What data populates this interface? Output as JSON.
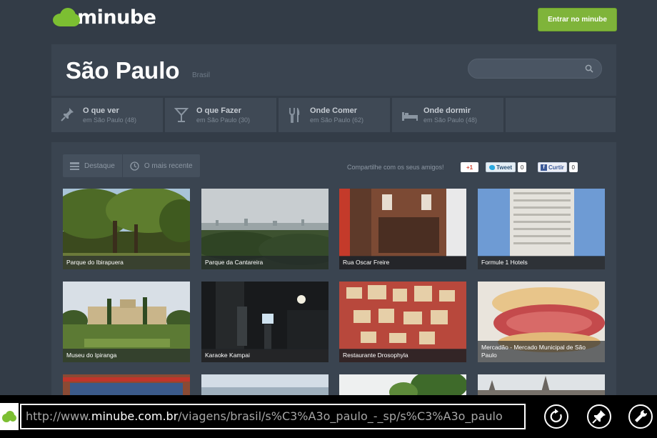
{
  "brand": {
    "logo_text": "minube",
    "accent": "#7fb43a"
  },
  "header": {
    "enter_button": "Entrar no minube"
  },
  "city": {
    "name": "São Paulo",
    "country": "Brasil",
    "search_placeholder": ""
  },
  "nav": [
    {
      "title": "O que ver",
      "sub": "em São Paulo (48)",
      "icon": "pin-icon"
    },
    {
      "title": "O que Fazer",
      "sub": "em São Paulo (30)",
      "icon": "cocktail-icon"
    },
    {
      "title": "Onde Comer",
      "sub": "em São Paulo (62)",
      "icon": "cutlery-icon"
    },
    {
      "title": "Onde dormir",
      "sub": "em São Paulo (48)",
      "icon": "bed-icon"
    }
  ],
  "view_tabs": [
    {
      "label": "Destaque",
      "icon": "list-icon"
    },
    {
      "label": "O mais recente",
      "icon": "clock-icon"
    }
  ],
  "share": {
    "text": "Compartilhe com os seus amigos!",
    "gplus": "+1",
    "tweet": "Tweet",
    "tweet_count": "0",
    "fb": "Curtir",
    "fb_count": "0"
  },
  "places": [
    "Parque do Ibirapuera",
    "Parque da Cantareira",
    "Rua Oscar Freire",
    "Formule 1 Hotels",
    "Museu do Ipiranga",
    "Karaoke Kampai",
    "Restaurante Drosophyla",
    "Mercadão - Mercado Municipal de São Paulo"
  ],
  "browser": {
    "url_prefix": "http://www.",
    "url_domain": "minube.com.br",
    "url_path": "/viagens/brasil/s%C3%A3o_paulo_-_sp/s%C3%A3o_paulo",
    "buttons": [
      "refresh-icon",
      "pin-icon",
      "tools-icon"
    ]
  }
}
